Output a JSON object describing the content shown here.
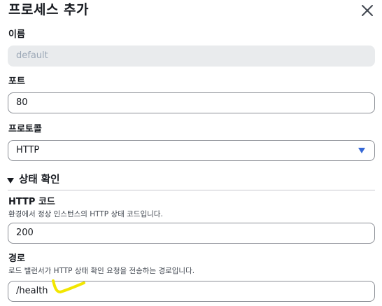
{
  "dialog": {
    "title": "프로세스 추가",
    "close_icon": "close-icon"
  },
  "name": {
    "label": "이름",
    "value": "default"
  },
  "port": {
    "label": "포트",
    "value": "80"
  },
  "protocol": {
    "label": "프로토콜",
    "selected": "HTTP"
  },
  "health_check": {
    "section_label": "상태 확인",
    "http_code": {
      "label": "HTTP 코드",
      "description": "환경에서 정상 인스턴스의 HTTP 상태 코드입니다.",
      "value": "200"
    },
    "path": {
      "label": "경로",
      "description": "로드 밸런서가 HTTP 상태 확인 요청을 전송하는 경로입니다.",
      "value": "/health"
    }
  },
  "colors": {
    "caret": "#3668d6",
    "annotation": "#f2e600"
  }
}
